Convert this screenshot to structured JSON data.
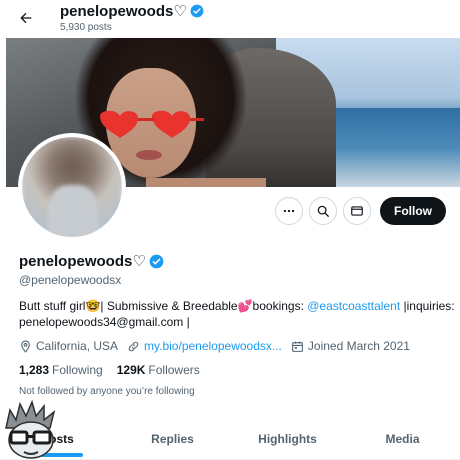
{
  "header": {
    "name": "penelopewoods♡",
    "posts_count": "5,930 posts"
  },
  "profile": {
    "name": "penelopewoods♡",
    "handle": "@penelopewoodsx",
    "bio_prefix": "Butt stuff girl🤓| Submissive & Breedable💕bookings: ",
    "bio_link": "@eastcoasttalent",
    "bio_suffix": " |inquiries:",
    "bio_line2": "penelopewoods34@gmail.com |",
    "location": "California, USA",
    "website": "my.bio/penelopewoodsx...",
    "joined": "Joined March 2021",
    "following_count": "1,283",
    "following_label": "Following",
    "followers_count": "129K",
    "followers_label": "Followers",
    "not_followed_text": "Not followed by anyone you’re following"
  },
  "actions": {
    "follow_label": "Follow"
  },
  "tabs": [
    {
      "label": "Posts",
      "active": true
    },
    {
      "label": "Replies",
      "active": false
    },
    {
      "label": "Highlights",
      "active": false
    },
    {
      "label": "Media",
      "active": false
    }
  ],
  "icons": {
    "back": "arrow-left-icon",
    "verified": "verified-badge-icon",
    "more": "more-icon",
    "search": "search-icon",
    "message": "mail-icon",
    "location": "location-pin-icon",
    "link": "link-icon",
    "calendar": "calendar-icon"
  },
  "colors": {
    "accent": "#1d9bf0",
    "text": "#0f1419",
    "secondary": "#536471",
    "follow_button": "#0f1419"
  }
}
